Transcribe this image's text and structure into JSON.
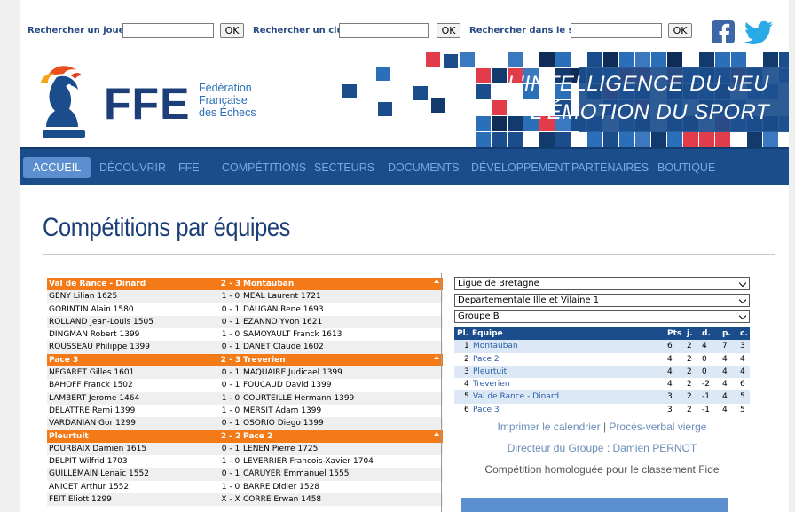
{
  "search": {
    "player_label": "Rechercher un joueur",
    "club_label": "Rechercher un club",
    "site_label": "Rechercher dans le site",
    "ok": "OK"
  },
  "social": [
    "facebook-icon",
    "twitter-icon"
  ],
  "header": {
    "logo_text": "FFE",
    "federation_line1": "Fédération",
    "federation_line2": "Française",
    "federation_line3": "des Échecs",
    "slogan_line1": "L'INTELLIGENCE DU JEU",
    "slogan_line2": "L'ÉMOTION DU SPORT"
  },
  "nav": [
    "ACCUEIL",
    "DÉCOUVRIR",
    "FFE",
    "COMPÉTITIONS",
    "SECTEURS",
    "DOCUMENTS",
    "DÉVELOPPEMENT",
    "PARTENAIRES",
    "BOUTIQUE"
  ],
  "page_title": "Compétitions par équipes",
  "matches": [
    {
      "home": "Val de Rance - Dinard",
      "score": "2 - 3",
      "away": "Montauban",
      "boards": [
        [
          "GENY Lilian 1625",
          "1 - 0",
          "MEAL Laurent 1721"
        ],
        [
          "GORINTIN Alain 1580",
          "0 - 1",
          "DAUGAN Rene 1693"
        ],
        [
          "ROLLAND Jean-Louis 1505",
          "0 - 1",
          "EZANNO Yvon 1621"
        ],
        [
          "DINGMAN Robert 1399",
          "1 - 0",
          "SAMOYAULT Franck 1613"
        ],
        [
          "ROUSSEAU Philippe 1399",
          "0 - 1",
          "DANET Claude 1602"
        ]
      ]
    },
    {
      "home": "Pace 3",
      "score": "2 - 3",
      "away": "Treverien",
      "boards": [
        [
          "NEGARET Gilles 1601",
          "0 - 1",
          "MAQUAIRE Judicael 1399"
        ],
        [
          "BAHOFF Franck 1502",
          "0 - 1",
          "FOUCAUD David 1399"
        ],
        [
          "LAMBERT Jerome 1464",
          "1 - 0",
          "COURTEILLE Hermann 1399"
        ],
        [
          "DELATTRE Remi 1399",
          "1 - 0",
          "MERSIT Adam 1399"
        ],
        [
          "VARDANIAN Gor 1299",
          "0 - 1",
          "OSORIO Diego 1399"
        ]
      ]
    },
    {
      "home": "Pleurtuit",
      "score": "2 - 2",
      "away": "Pace 2",
      "boards": [
        [
          "POURBAIX Damien 1615",
          "0 - 1",
          "LENEN Pierre 1725"
        ],
        [
          "DELPIT Wilfrid 1703",
          "1 - 0",
          "LEVERRIER Francois-Xavier 1704"
        ],
        [
          "GUILLEMAIN Lenaic 1552",
          "0 - 1",
          "CARUYER Emmanuel 1555"
        ],
        [
          "ANICET Arthur 1552",
          "1 - 0",
          "BARRE Didier 1528"
        ],
        [
          "FEIT Eliott 1299",
          "X - X",
          "CORRE Erwan 1458"
        ]
      ]
    }
  ],
  "selects": {
    "league": "Ligue de Bretagne",
    "division": "Departementale Ille et Vilaine 1",
    "group": "Groupe B"
  },
  "standings": {
    "headers": [
      "Pl.",
      "Equipe",
      "Pts",
      "j.",
      "d.",
      "p.",
      "c."
    ],
    "rows": [
      [
        "1",
        "Montauban",
        "6",
        "2",
        "4",
        "7",
        "3"
      ],
      [
        "2",
        "Pace 2",
        "4",
        "2",
        "0",
        "4",
        "4"
      ],
      [
        "3",
        "Pleurtuit",
        "4",
        "2",
        "0",
        "4",
        "4"
      ],
      [
        "4",
        "Treverien",
        "4",
        "2",
        "-2",
        "4",
        "6"
      ],
      [
        "5",
        "Val de Rance - Dinard",
        "3",
        "2",
        "-1",
        "4",
        "5"
      ],
      [
        "6",
        "Pace 3",
        "3",
        "2",
        "-1",
        "4",
        "5"
      ]
    ]
  },
  "links": {
    "print": "Imprimer le calendrier",
    "pipe": "|",
    "pv": "Procès-verbal vierge",
    "director": "Directeur du Groupe : Damien PERNOT",
    "fide": "Compétition homologuée pour le classement Fide"
  },
  "colors": {
    "navy": "#1b4d8c",
    "orange": "#f37a16",
    "accent_blue": "#5b8fcf"
  }
}
